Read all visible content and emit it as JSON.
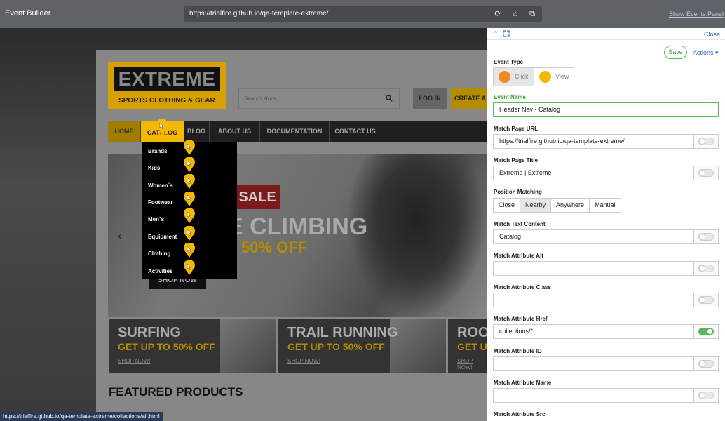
{
  "window": {
    "title": "Event Builder",
    "url": "https://trialfire.github.io/qa-template-extreme/",
    "show_panel": "Show Events Panel"
  },
  "site": {
    "logo": {
      "title": "EXTREME",
      "subtitle": "SPORTS CLOTHING & GEAR"
    },
    "search_placeholder": "Search store...",
    "login": "LOG IN",
    "create_account": "CREATE A",
    "nav": [
      "HOME",
      "CATALOG",
      "BLOG",
      "ABOUT US",
      "DOCUMENTATION",
      "CONTACT US"
    ],
    "catalog_overlay": "CAT",
    "catalog_tail": "OG",
    "dropdown": [
      "Brands",
      "Kids`",
      "Women`s",
      "Footwear",
      "Men`s",
      "Equipment",
      "Clothing",
      "Activities"
    ],
    "hero": {
      "sale": "SALE",
      "headline": "E CLIMBING",
      "offer": "50% OFF",
      "cta": "SHOP NOW"
    },
    "tiles": [
      {
        "title": "SURFING",
        "offer": "GET UP TO 50% OFF",
        "cta": "SHOP NOW!"
      },
      {
        "title": "TRAIL RUNNING",
        "offer": "GET UP TO 50% OFF",
        "cta": "SHOP NOW!"
      },
      {
        "title": "ROO",
        "offer": "GET U",
        "cta": "SHOP NOW!"
      }
    ],
    "featured": "FEATURED PRODUCTS",
    "status_url": "https://trialfire.github.io/qa-template-extreme/collections/all.html"
  },
  "panel": {
    "close": "Close",
    "save": "Save",
    "actions": "Actions ▾",
    "event_type_label": "Event Type",
    "event_types": [
      "Click",
      "View"
    ],
    "event_name_label": "Event Name",
    "event_name": "Header Nav - Catalog",
    "match_page_url_label": "Match Page URL",
    "match_page_url": "https://trialfire.github.io/qa-template-extreme/",
    "match_page_title_label": "Match Page Title",
    "match_page_title": "Extreme | Extreme",
    "position_matching_label": "Position Matching",
    "position_options": [
      "Close",
      "Nearby",
      "Anywhere",
      "Manual"
    ],
    "position_selected": "Nearby",
    "match_text_label": "Match Text Content",
    "match_text": "Catalog",
    "attr_alt_label": "Match Attribute Alt",
    "attr_class_label": "Match Attribute Class",
    "attr_href_label": "Match Attribute Href",
    "attr_href": "collections/*",
    "attr_id_label": "Match Attribute ID",
    "attr_name_label": "Match Attribute Name",
    "attr_src_label": "Match Attribute Src"
  },
  "colors": {
    "accent": "#2a6fc9",
    "green": "#5cb85c",
    "orange": "#f08a24",
    "yellow": "#f5b800"
  }
}
